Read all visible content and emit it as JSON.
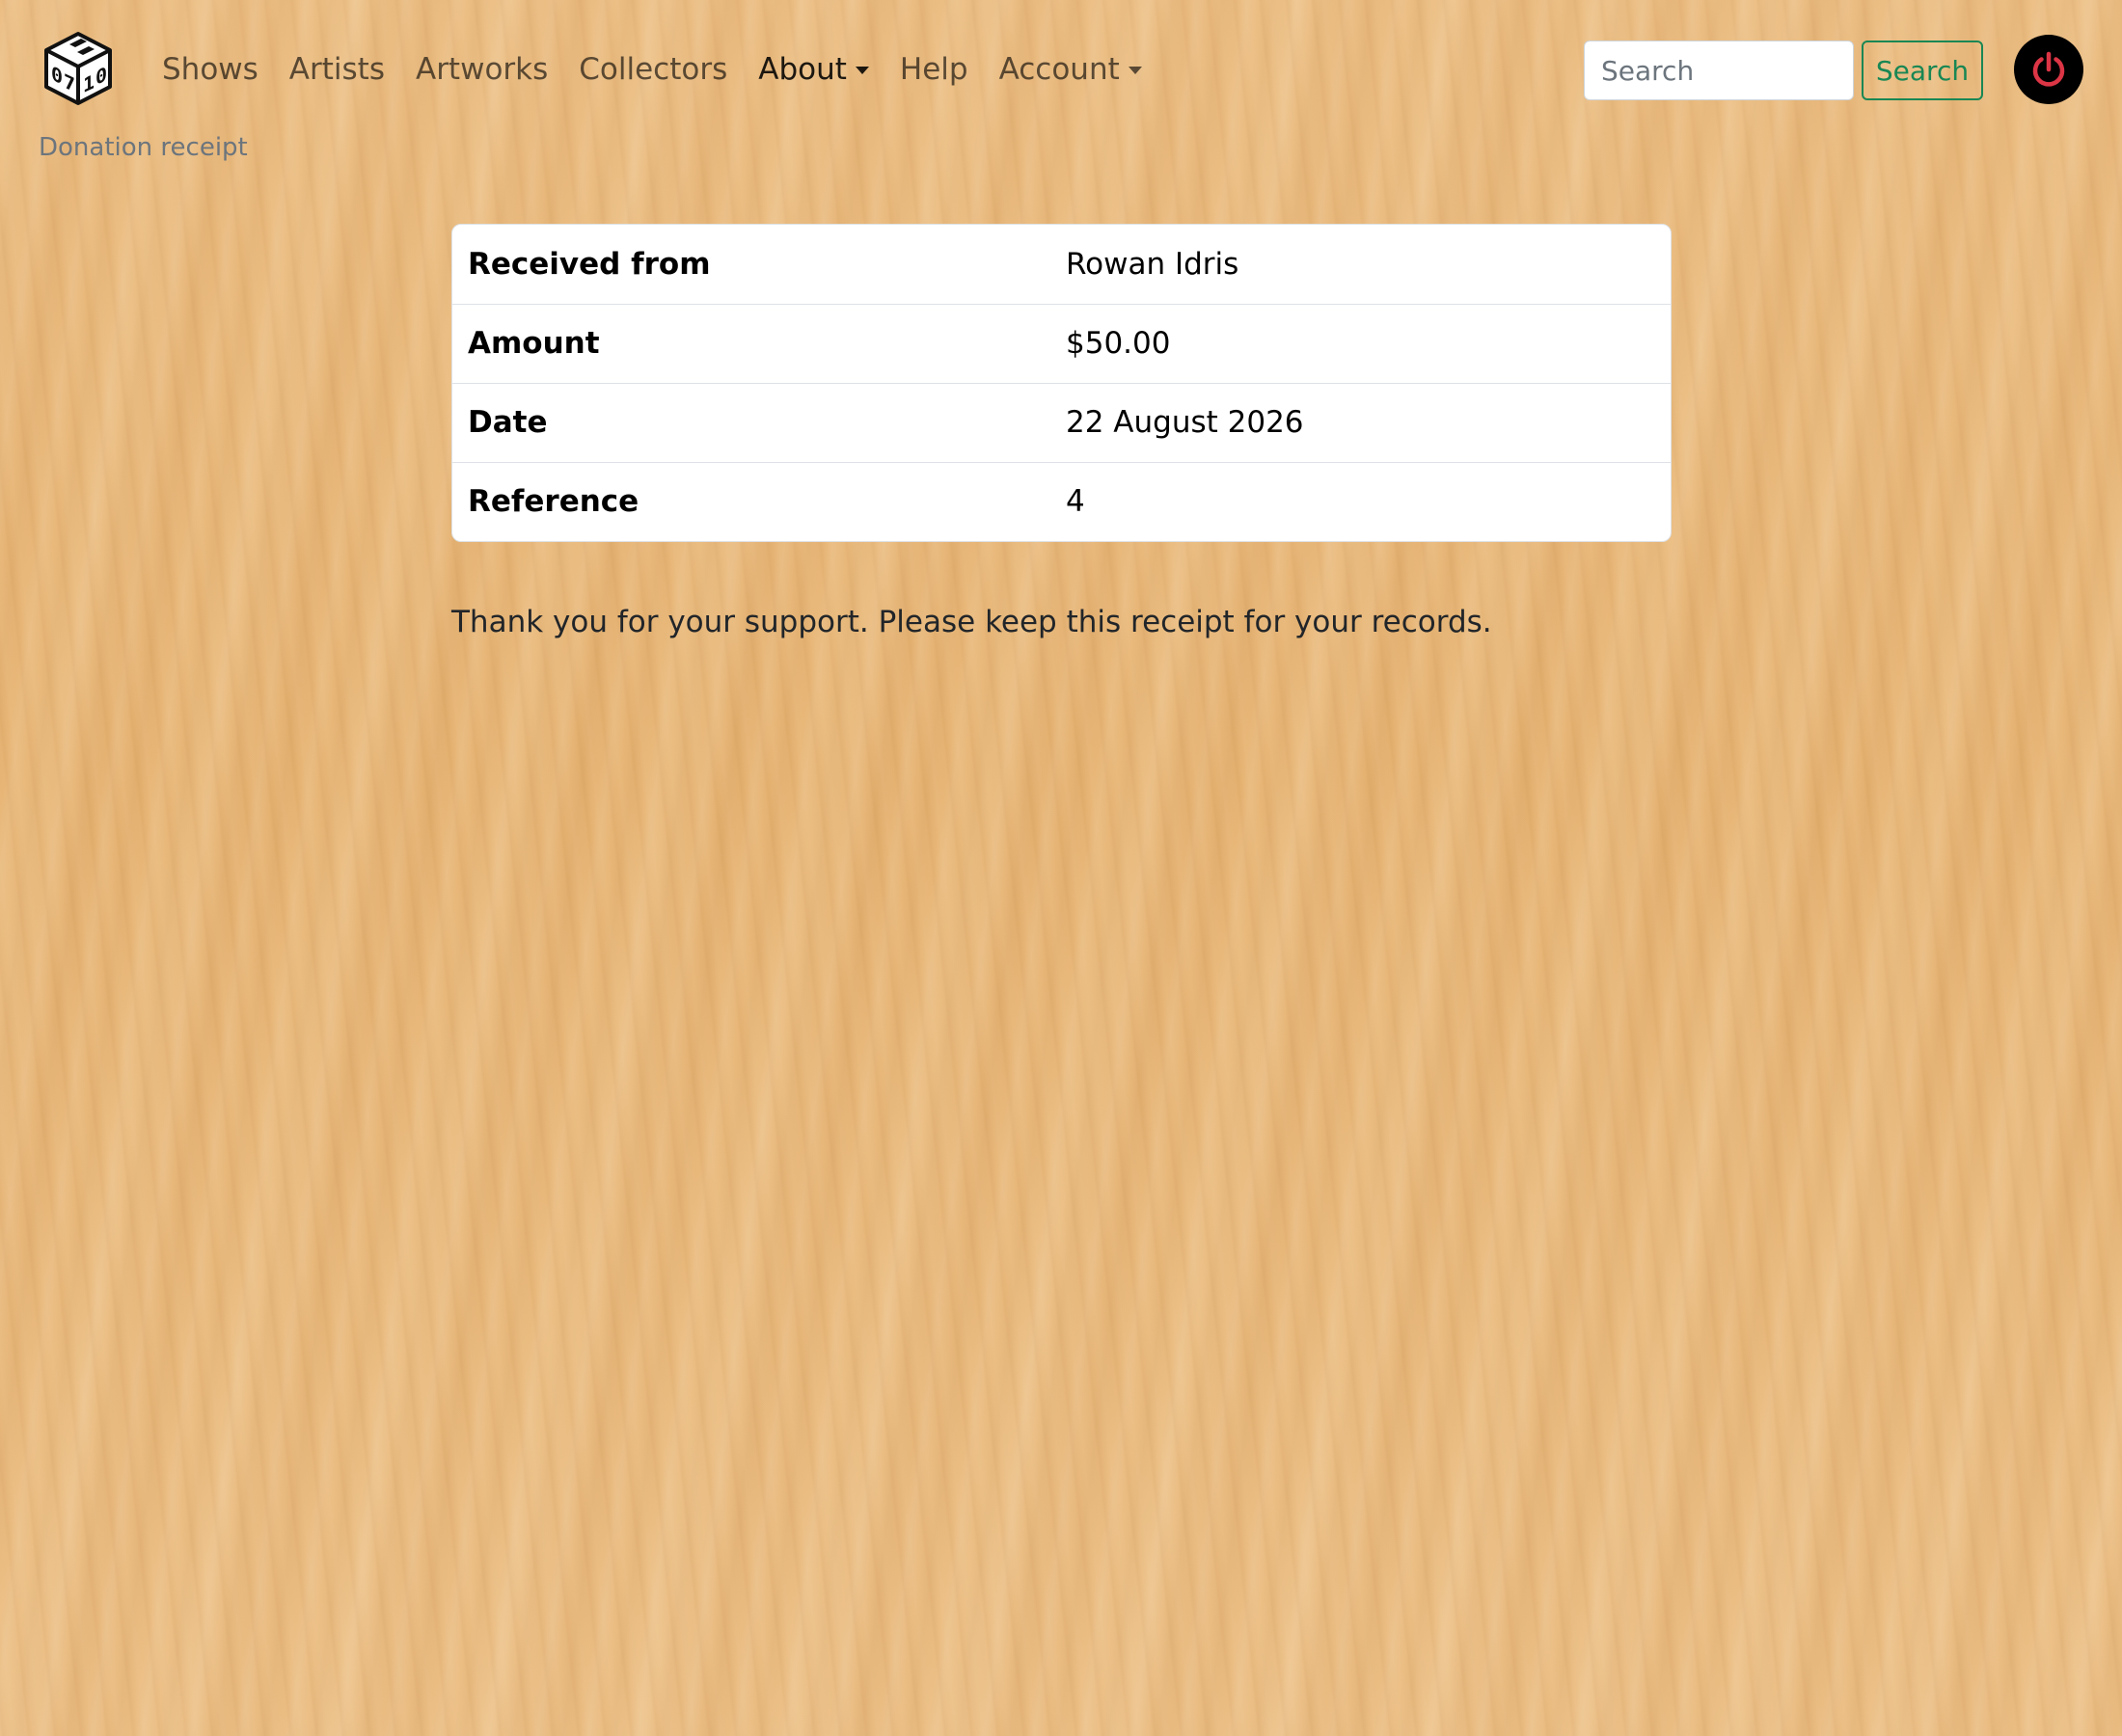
{
  "navbar": {
    "logo": {
      "icon": "cube-logo-icon",
      "digits": [
        "0",
        "7",
        "1",
        "0"
      ]
    },
    "links": [
      {
        "label": "Shows",
        "active": false,
        "dropdown": false
      },
      {
        "label": "Artists",
        "active": false,
        "dropdown": false
      },
      {
        "label": "Artworks",
        "active": false,
        "dropdown": false
      },
      {
        "label": "Collectors",
        "active": false,
        "dropdown": false
      },
      {
        "label": "About",
        "active": true,
        "dropdown": true
      },
      {
        "label": "Help",
        "active": false,
        "dropdown": false
      },
      {
        "label": "Account",
        "active": false,
        "dropdown": true
      }
    ],
    "search": {
      "placeholder": "Search",
      "value": "",
      "button_label": "Search",
      "button_color": "#198754"
    },
    "power": {
      "icon": "power-icon",
      "icon_color": "#dc3545",
      "background": "#000000"
    }
  },
  "breadcrumb": "Donation receipt",
  "receipt": {
    "rows": [
      {
        "label": "Received from",
        "value": "Rowan Idris"
      },
      {
        "label": "Amount",
        "value": "$50.00"
      },
      {
        "label": "Date",
        "value": "22 August 2026"
      },
      {
        "label": "Reference",
        "value": "4"
      }
    ]
  },
  "message": "Thank you for your support. Please keep this receipt for your records."
}
